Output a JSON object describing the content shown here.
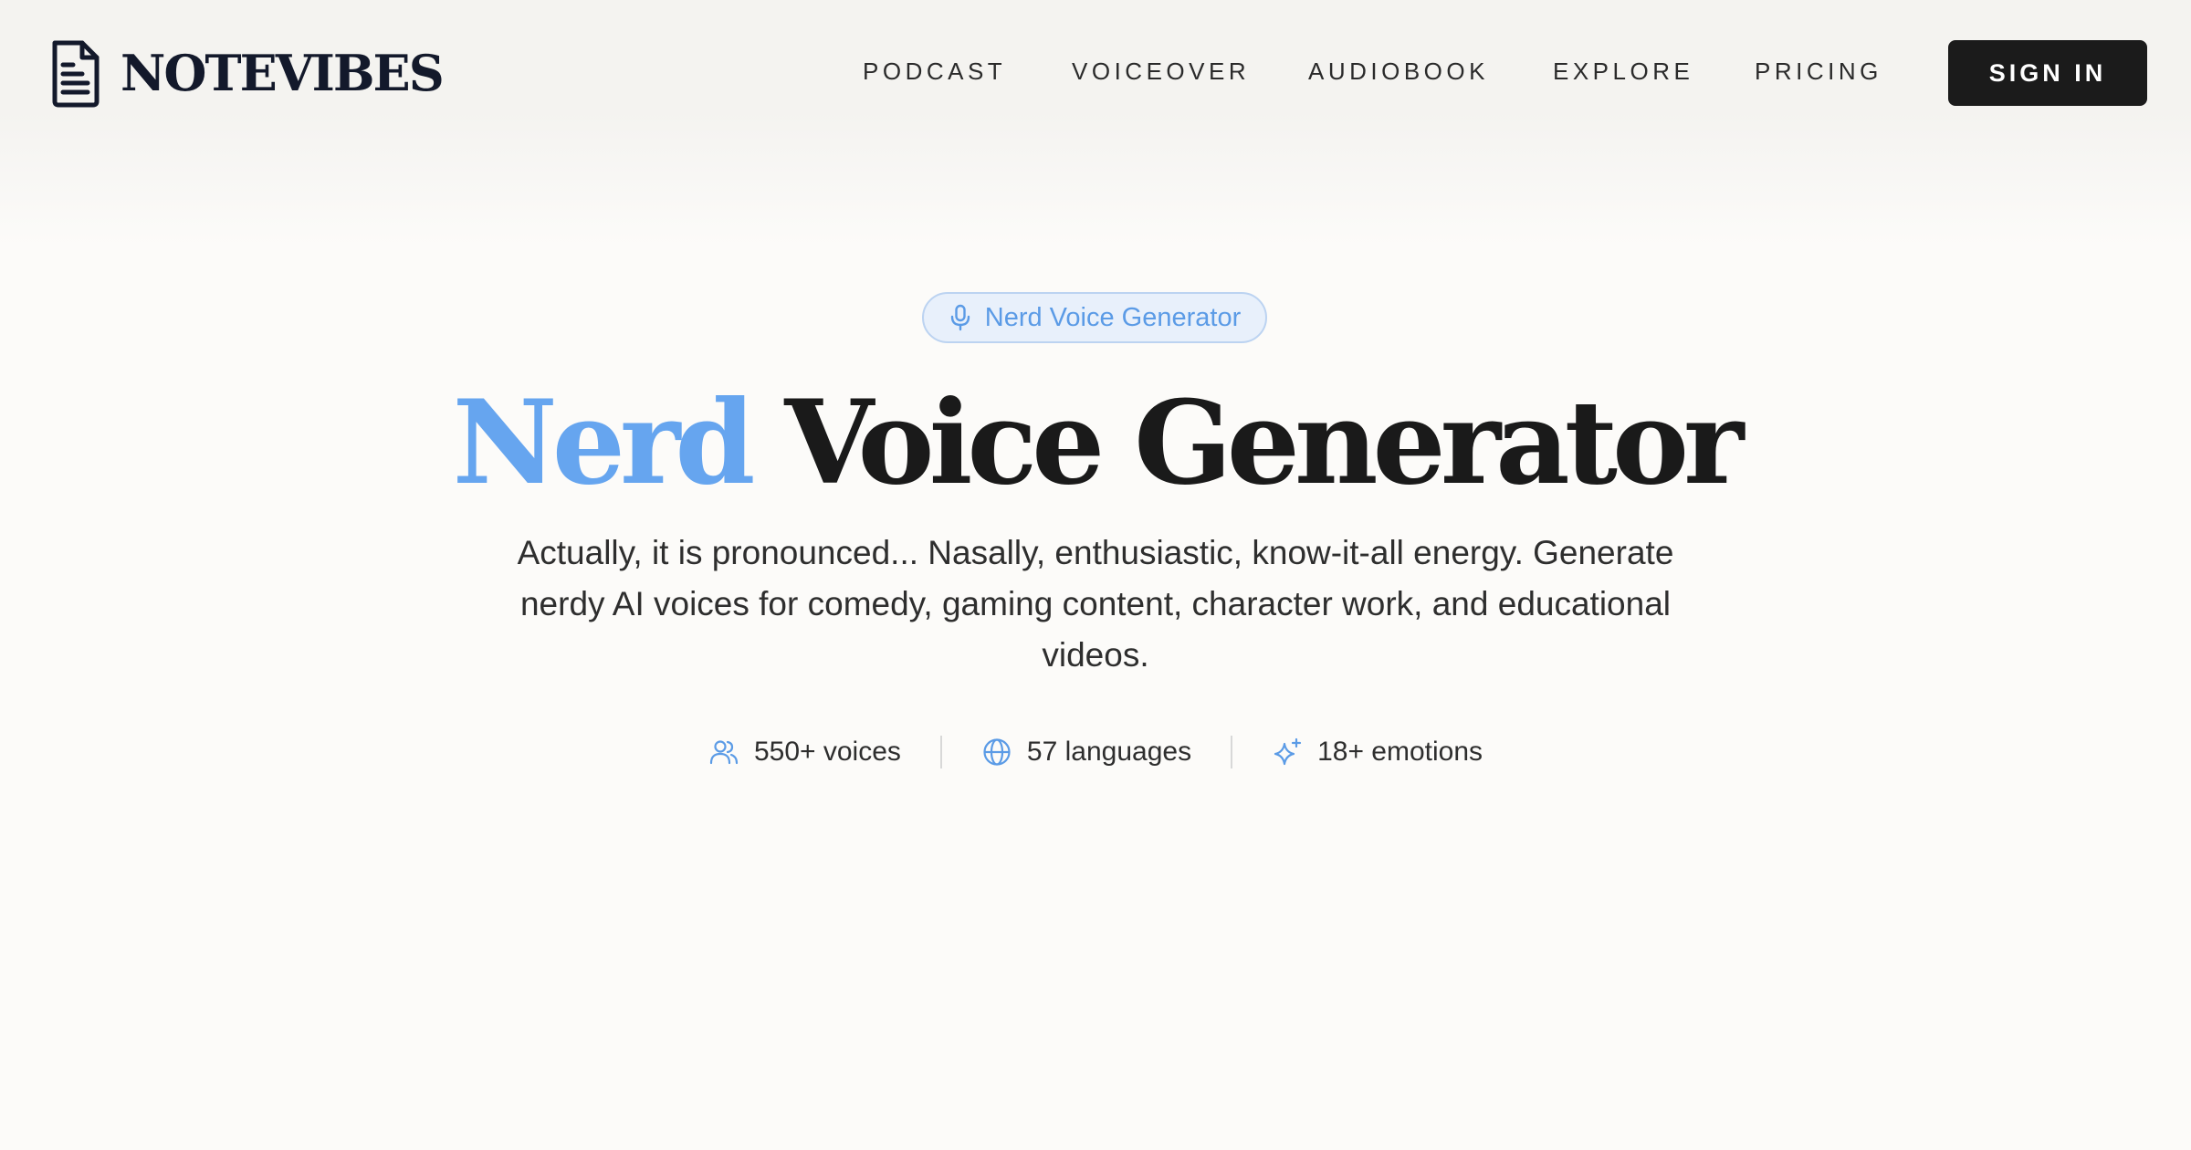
{
  "brand": {
    "name": "NOTEVIBES",
    "icon": "document-icon"
  },
  "nav": {
    "items": [
      {
        "label": "PODCAST"
      },
      {
        "label": "VOICEOVER"
      },
      {
        "label": "AUDIOBOOK"
      },
      {
        "label": "EXPLORE"
      },
      {
        "label": "PRICING"
      }
    ],
    "signin_label": "SIGN IN"
  },
  "hero": {
    "badge": {
      "icon": "microphone-icon",
      "label": "Nerd Voice Generator"
    },
    "title_accent": "Nerd",
    "title_rest": "Voice Generator",
    "subtitle": "Actually, it is pronounced... Nasally, enthusiastic, know-it-all energy. Generate nerdy AI voices for comedy, gaming content, character work, and educational videos.",
    "stats": [
      {
        "icon": "users-icon",
        "label": "550+ voices"
      },
      {
        "icon": "globe-icon",
        "label": "57 languages"
      },
      {
        "icon": "sparkle-icon",
        "label": "18+ emotions"
      }
    ]
  },
  "colors": {
    "accent": "#66a5ef",
    "badge_bg": "#e8f0fb",
    "button_bg": "#1b1b1b",
    "page_bg": "#fcfbf9",
    "logo": "#13192b"
  }
}
